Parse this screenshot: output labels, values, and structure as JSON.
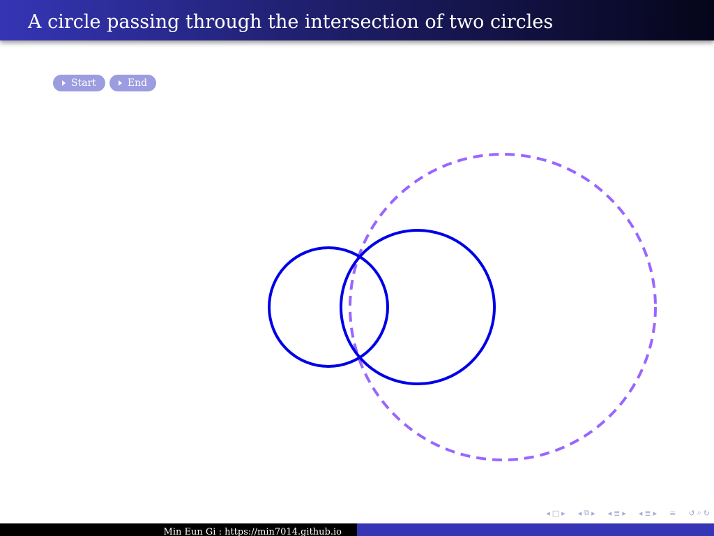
{
  "slide": {
    "title": "A circle passing through the intersection of two circles"
  },
  "buttons": [
    {
      "label": "Start",
      "icon": "play-triangle-icon"
    },
    {
      "label": "End",
      "icon": "play-triangle-icon"
    }
  ],
  "colors": {
    "title_gradient_start": "#3535b5",
    "title_gradient_end": "#05051a",
    "button_bg": "#9c9ce0",
    "solid_circles": "#0000e6",
    "dashed_circle": "#9966ff",
    "footer_left": "#000000",
    "footer_right": "#3535b5",
    "nav_icons": "#a8a8d6"
  },
  "navigation": {
    "icons": [
      "nav-prev-slide-icon",
      "nav-slide-icon",
      "nav-next-slide-icon",
      "nav-prev-frame-icon",
      "nav-frame-icon",
      "nav-next-frame-icon",
      "nav-prev-subsection-icon",
      "nav-subsection-icon",
      "nav-next-subsection-icon",
      "nav-prev-section-icon",
      "nav-section-icon",
      "nav-next-section-icon",
      "nav-document-icon",
      "nav-undo-icon",
      "nav-search-icon",
      "nav-redo-icon"
    ]
  },
  "footer": {
    "text": "Min Eun Gi : https://min7014.github.io"
  }
}
